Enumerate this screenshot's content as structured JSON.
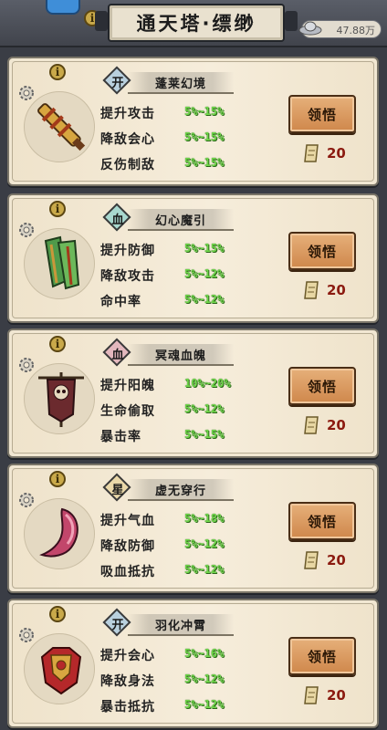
{
  "header": {
    "title": "通天塔·缥缈",
    "currency": "47.88万"
  },
  "cards": [
    {
      "type_char": "开",
      "type_color": "#b9d0de",
      "name": "蓬莱幻境",
      "item_icon": "golden-whip-icon",
      "stats": [
        {
          "label": "提升攻击",
          "value": "5%~15%"
        },
        {
          "label": "降敌会心",
          "value": "5%~15%"
        },
        {
          "label": "反伤制敌",
          "value": "5%~15%"
        }
      ],
      "button": "领悟",
      "cost": "20"
    },
    {
      "type_char": "血",
      "type_color": "#a8d8cf",
      "name": "幻心魔引",
      "item_icon": "green-banner-icon",
      "stats": [
        {
          "label": "提升防御",
          "value": "5%~15%"
        },
        {
          "label": "降敌攻击",
          "value": "5%~12%"
        },
        {
          "label": "命中率",
          "value": "5%~12%"
        }
      ],
      "button": "领悟",
      "cost": "20"
    },
    {
      "type_char": "血",
      "type_color": "#e3b7bd",
      "name": "冥魂血魄",
      "item_icon": "skull-banner-icon",
      "stats": [
        {
          "label": "提升阳魄",
          "value": "10%~20%"
        },
        {
          "label": "生命偷取",
          "value": "5%~12%"
        },
        {
          "label": "暴击率",
          "value": "5%~15%"
        }
      ],
      "button": "领悟",
      "cost": "20"
    },
    {
      "type_char": "星",
      "type_color": "#ead8a9",
      "name": "虚无穿行",
      "item_icon": "horn-icon",
      "stats": [
        {
          "label": "提升气血",
          "value": "5%~18%"
        },
        {
          "label": "降敌防御",
          "value": "5%~12%"
        },
        {
          "label": "吸血抵抗",
          "value": "5%~12%"
        }
      ],
      "button": "领悟",
      "cost": "20"
    },
    {
      "type_char": "开",
      "type_color": "#b9d0de",
      "name": "羽化冲霄",
      "item_icon": "red-armor-icon",
      "stats": [
        {
          "label": "提升会心",
          "value": "5%~16%"
        },
        {
          "label": "降敌身法",
          "value": "5%~12%"
        },
        {
          "label": "暴击抵抗",
          "value": "5%~12%"
        }
      ],
      "button": "领悟",
      "cost": "20"
    }
  ]
}
